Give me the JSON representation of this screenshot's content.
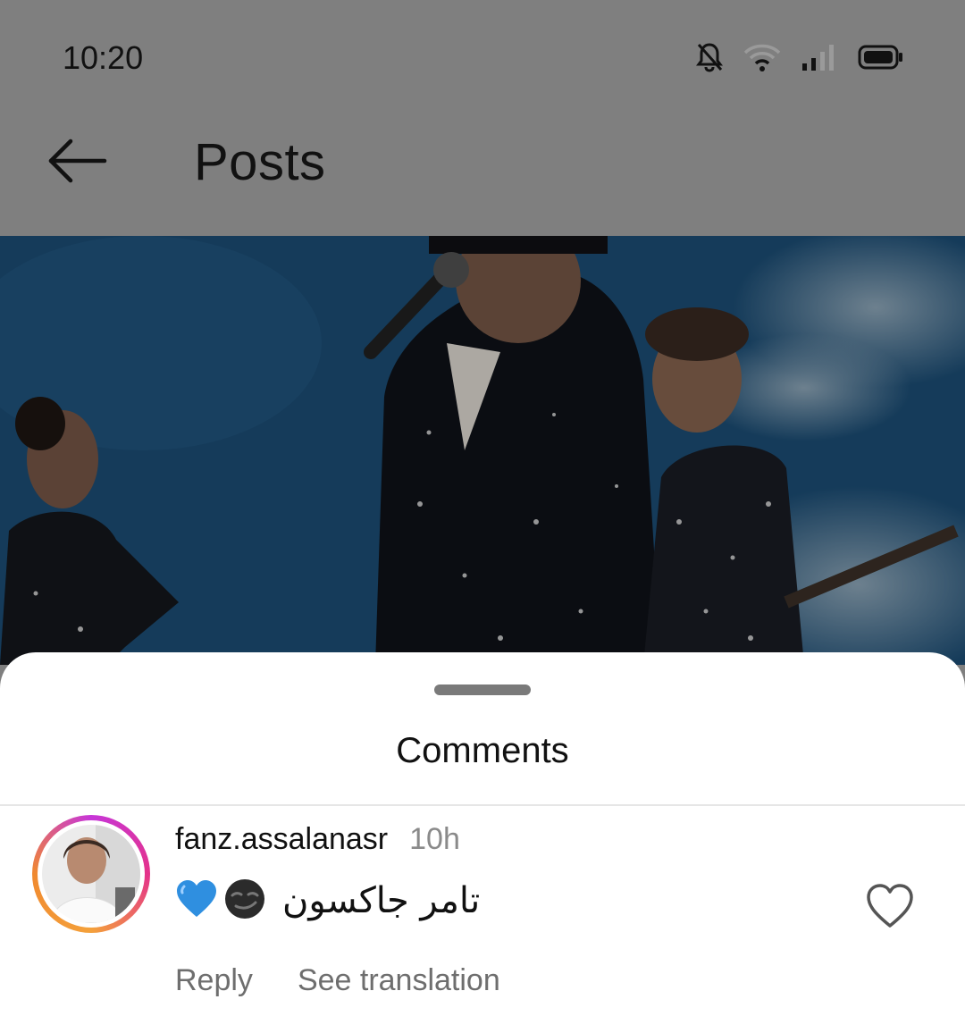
{
  "status_bar": {
    "time": "10:20",
    "icons": [
      "bell-muted-icon",
      "wifi-icon",
      "signal-icon",
      "battery-icon"
    ]
  },
  "header": {
    "title": "Posts",
    "back_icon": "arrow-left-icon"
  },
  "comments_sheet": {
    "title": "Comments",
    "comment": {
      "username": "fanz.assalanasr",
      "time": "10h",
      "text": "تامر جاكسون",
      "emojis": [
        "smirk-face-emoji",
        "blue-heart-emoji"
      ],
      "reply_label": "Reply",
      "translate_label": "See translation",
      "like_icon": "heart-outline-icon"
    }
  },
  "colors": {
    "overlay": "#7f7f7f",
    "sheet_bg": "#ffffff",
    "secondary_text": "#6e6e6e",
    "story_ring": [
      "#c736d8",
      "#e4328a",
      "#f4a13b"
    ]
  }
}
